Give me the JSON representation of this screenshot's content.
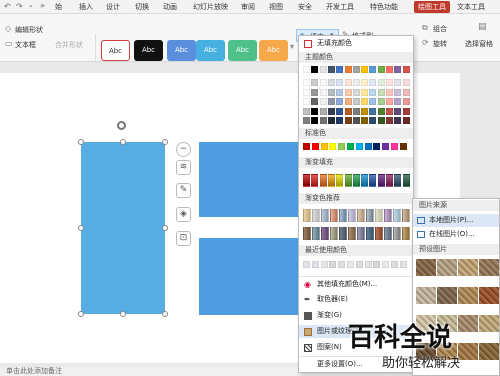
{
  "menubar": {
    "tabs": [
      "始",
      "插入",
      "设计",
      "切换",
      "动画",
      "幻灯片放映",
      "审阅",
      "视图",
      "安全",
      "开发工具",
      "特色功能",
      "绘图工具",
      "文本工具"
    ]
  },
  "ribbon": {
    "edit_shape": "编辑形状",
    "text_box": "文本框",
    "merge_shape": "合并形状",
    "style_label": "Abc",
    "fill": "填充",
    "format_brush": "格式刷",
    "group": "组合",
    "rotate": "旋转",
    "select_pane": "选择窗格"
  },
  "dropdown": {
    "no_fill": "无填充颜色",
    "theme_colors_header": "主题颜色",
    "standard_colors_header": "标准色",
    "gradient_fill_header": "渐变填充",
    "gradient_recommend_header": "渐变色推荐",
    "recent_colors_header": "最近使用颜色",
    "more_fill_colors": "其他填充颜色(M)...",
    "eyedropper": "取色器(E)",
    "gradient": "渐变(G)",
    "picture_texture": "图片或纹理(T)",
    "pattern": "图案(N)",
    "more_settings": "更多设置(O)...",
    "theme_top_row": [
      "#ffffff",
      "#000000",
      "#e7e6e6",
      "#44546a",
      "#4472c4",
      "#ed7d31",
      "#a5a5a5",
      "#ffc000",
      "#5b9bd5",
      "#70ad47",
      "#ff6f61",
      "#8064a2",
      "#d9534f"
    ],
    "standard_colors": [
      "#c00000",
      "#ff0000",
      "#ffc000",
      "#ffff00",
      "#92d050",
      "#00b050",
      "#00b0f0",
      "#0070c0",
      "#002060",
      "#7030a0",
      "#ff3399",
      "#663300"
    ],
    "gradient_colors": [
      "#c00000",
      "#e02020",
      "#f07020",
      "#f0a000",
      "#e8e000",
      "#60b030",
      "#20a050",
      "#1090d0",
      "#2050b0",
      "#602080",
      "#902060",
      "#305070",
      "#206040"
    ],
    "gradient_recommend": [
      "#c9a86a",
      "#b8b8b8",
      "#8a9ab0",
      "#c07050",
      "#6080a0",
      "#a0a0c0",
      "#b09070",
      "#708090",
      "#c0c0a0",
      "#9070a0",
      "#90b0c0",
      "#a08060"
    ]
  },
  "submenu": {
    "picture_source_header": "图片来源",
    "local_picture": "本地图片(P)...",
    "online_picture": "在线图片(O)...",
    "preset_picture_header": "预设图片",
    "textures": [
      "#8a6a4a",
      "#b9a68a",
      "#c6a878",
      "#9a7a5a",
      "#c9b9a2",
      "#7f6a50",
      "#b48e5a",
      "#a0552e",
      "#d6c8a8",
      "#cbbf9a",
      "#aa9070",
      "#c4ac7c",
      "#6b4f32",
      "#b08850",
      "#a87a48",
      "#8a6a3a"
    ]
  },
  "status": {
    "notes": "单击此处添加备注"
  },
  "watermark": {
    "main": "百科全说",
    "sub": "助你轻松解决"
  }
}
